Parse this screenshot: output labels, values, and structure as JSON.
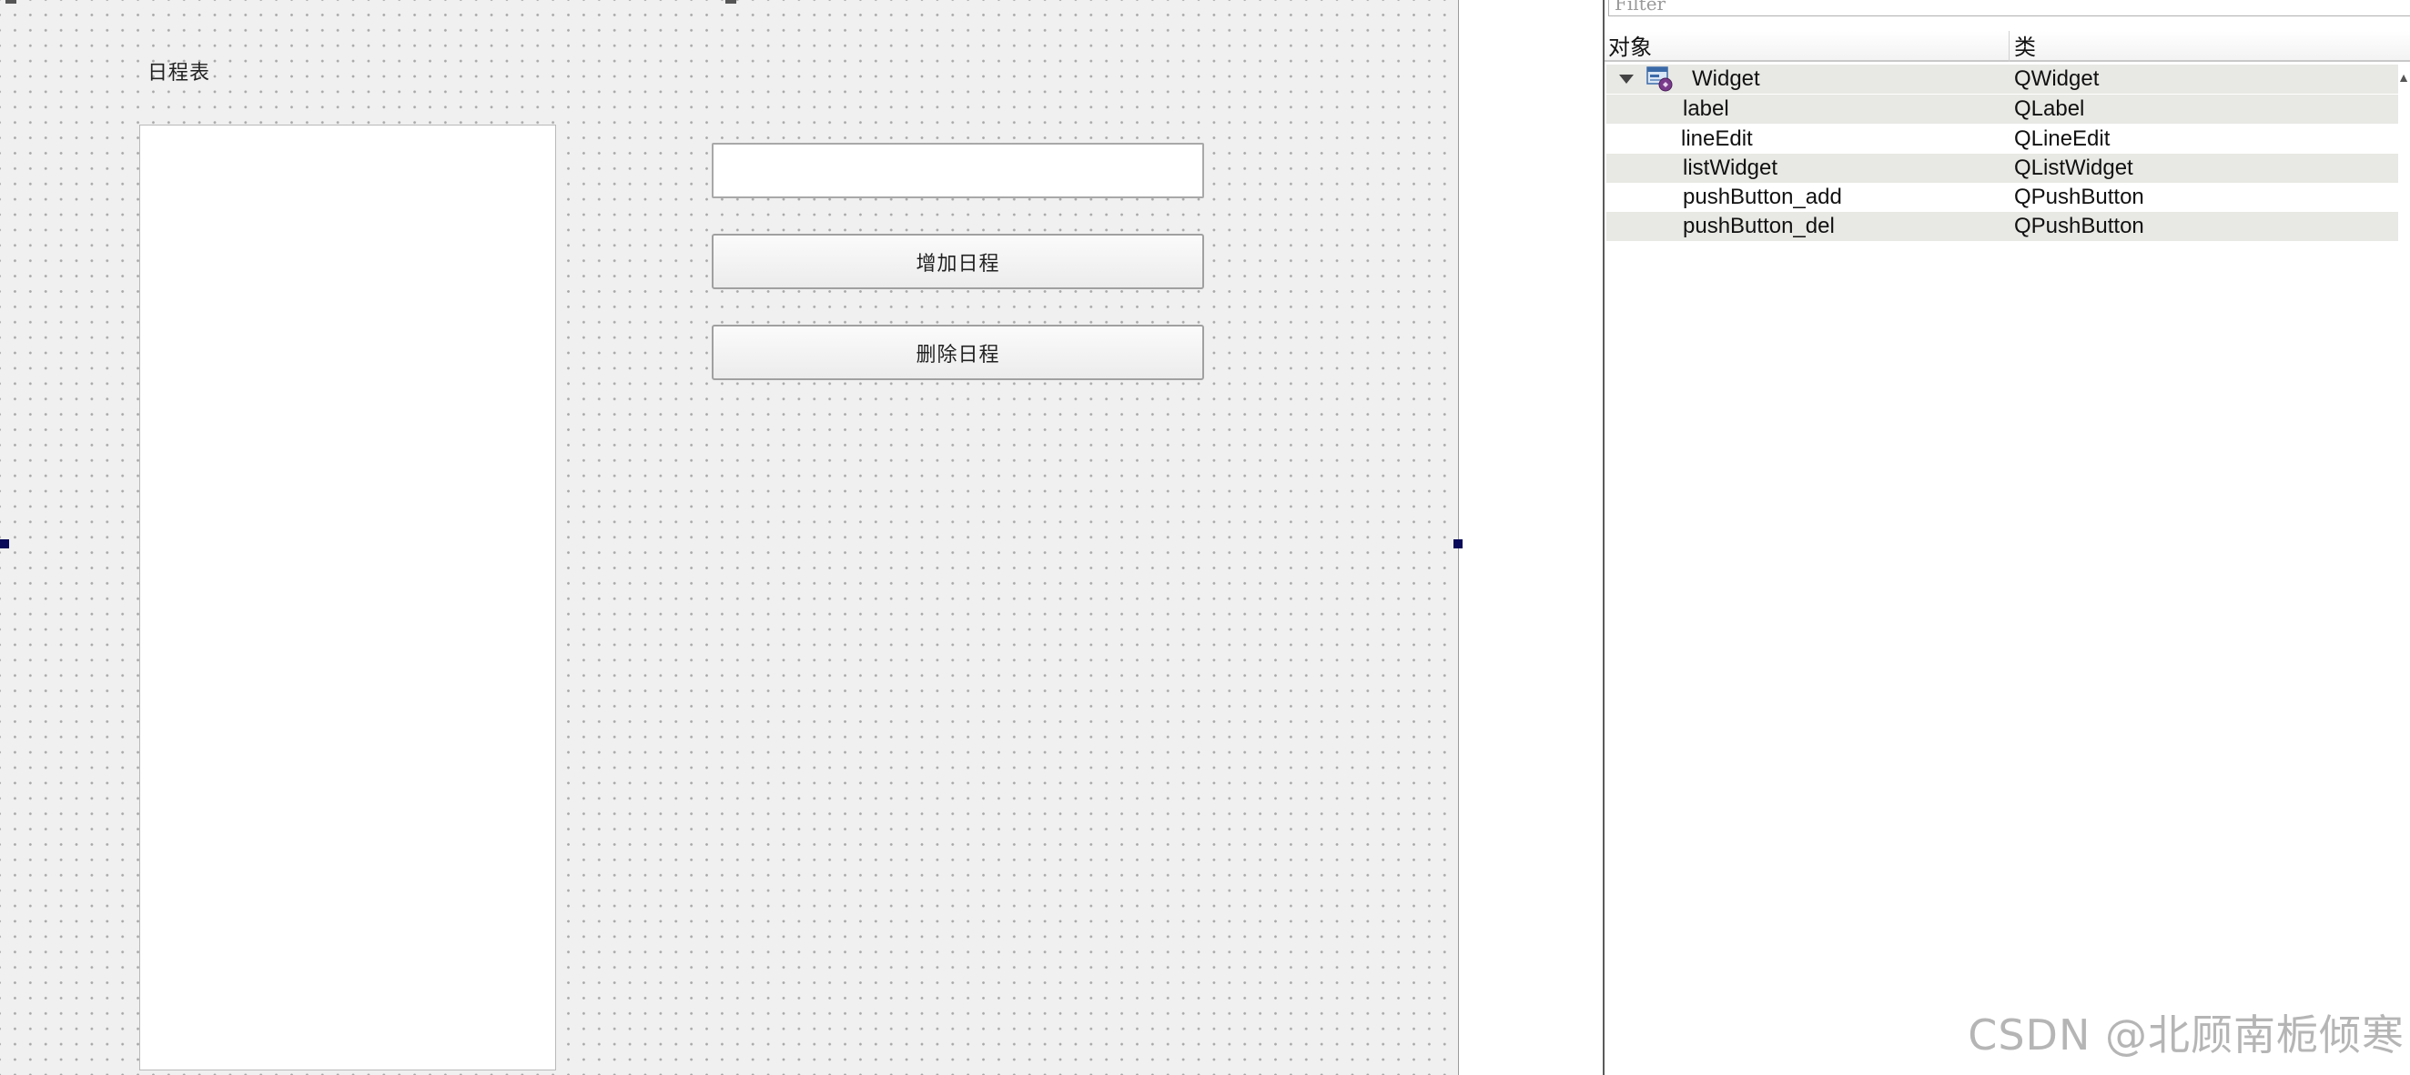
{
  "form": {
    "label_text": "日程表",
    "line_edit_value": "",
    "add_button_label": "增加日程",
    "delete_button_label": "删除日程"
  },
  "inspector": {
    "filter_placeholder": "Filter",
    "column_object": "对象",
    "column_class": "类",
    "root": {
      "name": "Widget",
      "class": "QWidget",
      "icon": "widget-icon",
      "expanded": true
    },
    "children": [
      {
        "name": "label",
        "class": "QLabel"
      },
      {
        "name": "lineEdit",
        "class": "QLineEdit"
      },
      {
        "name": "listWidget",
        "class": "QListWidget"
      },
      {
        "name": "pushButton_add",
        "class": "QPushButton"
      },
      {
        "name": "pushButton_del",
        "class": "QPushButton"
      }
    ]
  },
  "watermark": "CSDN @北顾南栀倾寒",
  "colors": {
    "form_background": "#f0f0f0",
    "grid_dot": "#a8a8a8",
    "selection_handle": "#0a0a5a",
    "alt_row": "#e8e8e4"
  }
}
